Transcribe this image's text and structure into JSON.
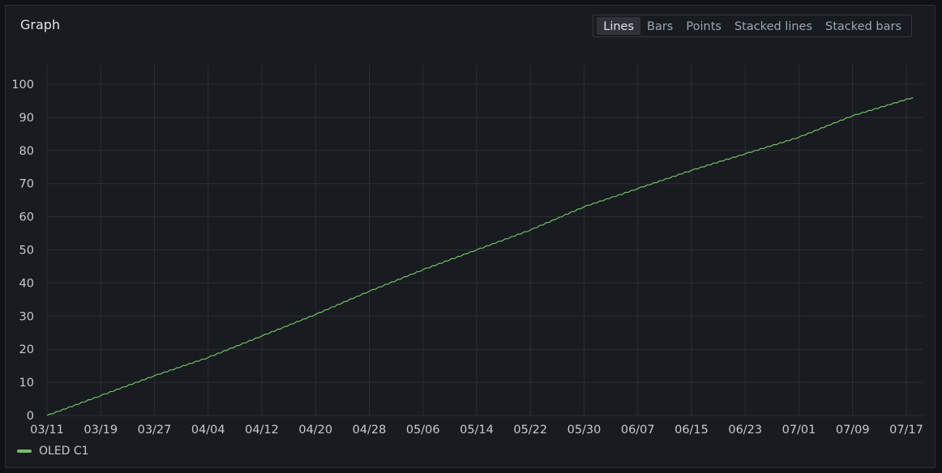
{
  "panel": {
    "title": "Graph"
  },
  "view_modes": {
    "options": [
      "Lines",
      "Bars",
      "Points",
      "Stacked lines",
      "Stacked bars"
    ],
    "selected": "Lines"
  },
  "colors": {
    "series": "#73bf69",
    "grid": "#2b2e33",
    "background": "#181b1f"
  },
  "chart_data": {
    "type": "line",
    "title": "",
    "xlabel": "",
    "ylabel": "",
    "ylim": [
      0,
      100
    ],
    "yticks": [
      0,
      10,
      20,
      30,
      40,
      50,
      60,
      70,
      80,
      90,
      100
    ],
    "xticks": [
      "03/11",
      "03/19",
      "03/27",
      "04/04",
      "04/12",
      "04/20",
      "04/28",
      "05/06",
      "05/14",
      "05/22",
      "05/30",
      "06/07",
      "06/15",
      "06/23",
      "07/01",
      "07/09",
      "07/17"
    ],
    "grid": true,
    "legend_position": "bottom-left",
    "series": [
      {
        "name": "OLED C1",
        "color": "#73bf69",
        "points": [
          [
            "03/11",
            0
          ],
          [
            "03/19",
            6
          ],
          [
            "03/27",
            12
          ],
          [
            "04/04",
            17.5
          ],
          [
            "04/12",
            24
          ],
          [
            "04/20",
            30.5
          ],
          [
            "04/28",
            37.5
          ],
          [
            "05/06",
            44
          ],
          [
            "05/14",
            50
          ],
          [
            "05/22",
            56
          ],
          [
            "05/30",
            63
          ],
          [
            "06/07",
            68.5
          ],
          [
            "06/15",
            74
          ],
          [
            "06/23",
            79
          ],
          [
            "07/01",
            84
          ],
          [
            "07/09",
            90.5
          ],
          [
            "07/18",
            96
          ]
        ]
      }
    ]
  }
}
